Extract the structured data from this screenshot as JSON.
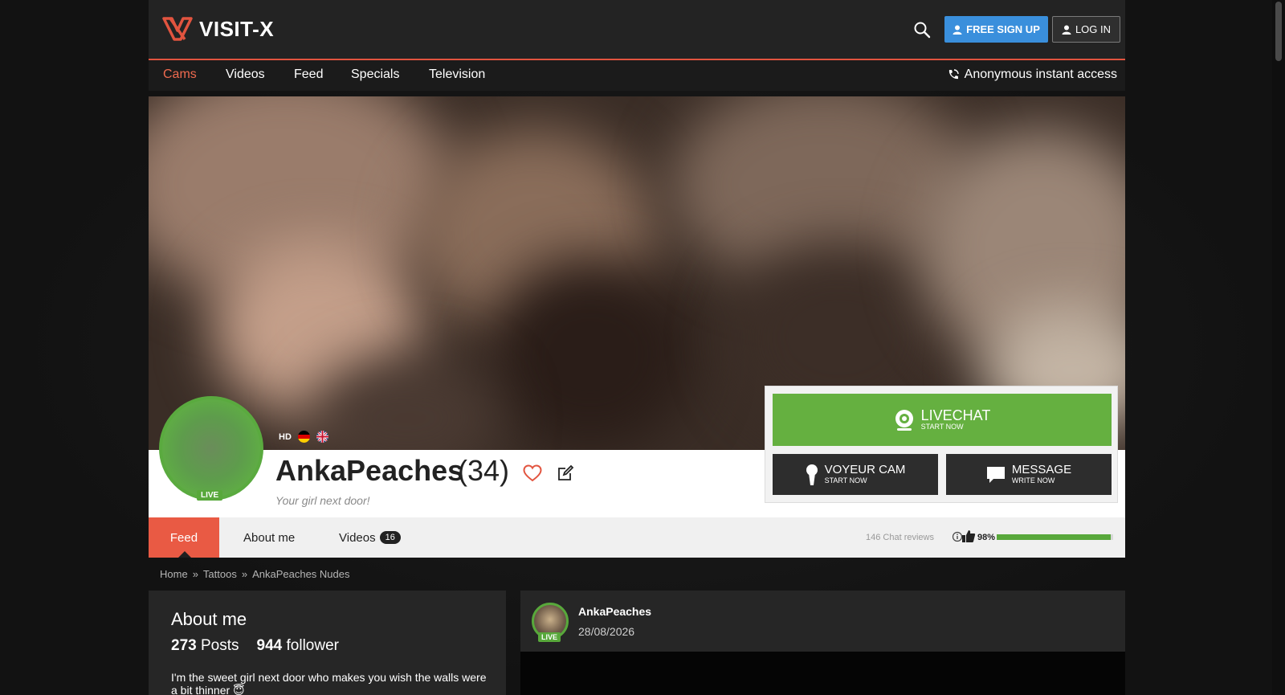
{
  "brand": {
    "name": "VISIT-X",
    "accent": "#e2543f"
  },
  "header": {
    "signup_label": "FREE SIGN UP",
    "login_label": "LOG IN"
  },
  "nav": {
    "items": [
      {
        "label": "Cams",
        "active": true
      },
      {
        "label": "Videos"
      },
      {
        "label": "Feed"
      },
      {
        "label": "Specials"
      },
      {
        "label": "Television"
      }
    ],
    "anonymous_label": "Anonymous instant access"
  },
  "profile": {
    "live_label": "LIVE",
    "hd_label": "HD",
    "languages": [
      "de-flag",
      "uk-flag"
    ],
    "name": "AnkaPeaches",
    "age": "(34)",
    "tagline": "Your girl next door!"
  },
  "actions": {
    "livechat_title": "LIVECHAT",
    "livechat_sub": "START NOW",
    "voyeur_title": "VOYEUR CAM",
    "voyeur_sub": "START NOW",
    "message_title": "MESSAGE",
    "message_sub": "WRITE NOW"
  },
  "tabs": [
    {
      "label": "Feed",
      "active": true
    },
    {
      "label": "About me"
    },
    {
      "label": "Videos",
      "count": "16"
    }
  ],
  "rating": {
    "reviews_label": "146 Chat reviews",
    "percent_label": "98%",
    "percent": 98
  },
  "breadcrumb": {
    "items": [
      "Home",
      "Tattoos",
      "AnkaPeaches Nudes"
    ],
    "separator": "»"
  },
  "about": {
    "title": "About me",
    "posts_count": "273",
    "posts_label": "Posts",
    "follower_count": "944",
    "follower_label": "follower",
    "text": "I'm the sweet girl next door who makes you wish the walls were a bit thinner 😇"
  },
  "post": {
    "author": "AnkaPeaches",
    "date": "28/08/2026",
    "live_label": "LIVE"
  },
  "colors": {
    "live_green": "#58a83b",
    "livechat_green": "#65b040",
    "signup_blue": "#3a8fdc",
    "tab_active": "#e95a44"
  }
}
